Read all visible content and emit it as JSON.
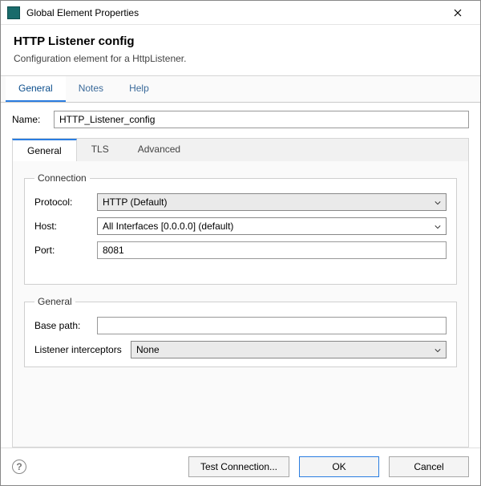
{
  "window": {
    "title": "Global Element Properties"
  },
  "header": {
    "title": "HTTP Listener config",
    "subtitle": "Configuration element for a HttpListener."
  },
  "outerTabs": {
    "general": "General",
    "notes": "Notes",
    "help": "Help"
  },
  "nameRow": {
    "label": "Name:",
    "value": "HTTP_Listener_config"
  },
  "innerTabs": {
    "general": "General",
    "tls": "TLS",
    "advanced": "Advanced"
  },
  "connection": {
    "legend": "Connection",
    "protocolLabel": "Protocol:",
    "protocolValue": "HTTP (Default)",
    "hostLabel": "Host:",
    "hostValue": "All Interfaces [0.0.0.0] (default)",
    "portLabel": "Port:",
    "portValue": "8081"
  },
  "generalGroup": {
    "legend": "General",
    "basePathLabel": "Base path:",
    "basePathValue": "",
    "interceptorsLabel": "Listener interceptors",
    "interceptorsValue": "None"
  },
  "footer": {
    "test": "Test Connection...",
    "ok": "OK",
    "cancel": "Cancel"
  }
}
